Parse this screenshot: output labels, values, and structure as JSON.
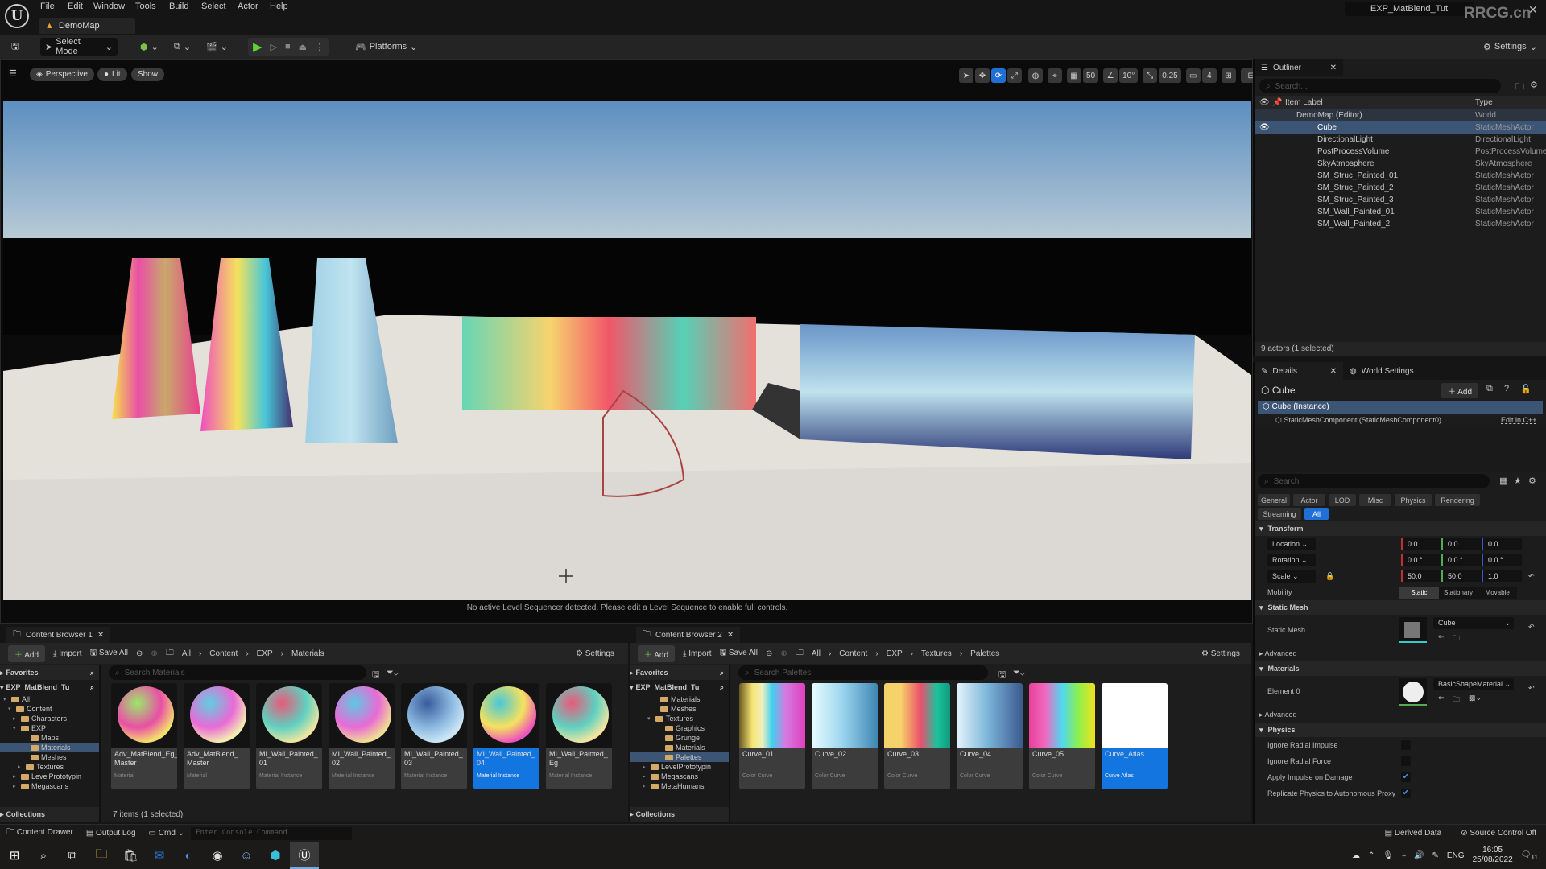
{
  "app": {
    "menu": [
      "File",
      "Edit",
      "Window",
      "Tools",
      "Build",
      "Select",
      "Actor",
      "Help"
    ],
    "map_tab": "DemoMap",
    "project_title": "EXP_MatBlend_Tut",
    "watermark": "RRCG.cn"
  },
  "toolbar": {
    "select_mode": "Select Mode",
    "platforms": "Platforms",
    "settings": "Settings"
  },
  "viewport": {
    "perspective": "Perspective",
    "lit": "Lit",
    "show": "Show",
    "grid_snap": "50",
    "rotation_snap": "10°",
    "scale_snap": "0.25",
    "camera_speed": "4",
    "sequencer_message": "No active Level Sequencer detected. Please edit a Level Sequence to enable full controls."
  },
  "outliner": {
    "tab": "Outliner",
    "search_placeholder": "Search...",
    "col_label": "Item Label",
    "col_type": "Type",
    "rows": [
      {
        "label": "DemoMap (Editor)",
        "type": "World"
      },
      {
        "label": "Cube",
        "type": "StaticMeshActor"
      },
      {
        "label": "DirectionalLight",
        "type": "DirectionalLight"
      },
      {
        "label": "PostProcessVolume",
        "type": "PostProcessVolume"
      },
      {
        "label": "SkyAtmosphere",
        "type": "SkyAtmosphere"
      },
      {
        "label": "SM_Struc_Painted_01",
        "type": "StaticMeshActor"
      },
      {
        "label": "SM_Struc_Painted_2",
        "type": "StaticMeshActor"
      },
      {
        "label": "SM_Struc_Painted_3",
        "type": "StaticMeshActor"
      },
      {
        "label": "SM_Wall_Painted_01",
        "type": "StaticMeshActor"
      },
      {
        "label": "SM_Wall_Painted_2",
        "type": "StaticMeshActor"
      }
    ],
    "status": "9 actors (1 selected)"
  },
  "details": {
    "tab": "Details",
    "world_settings_tab": "World Settings",
    "actor_name": "Cube",
    "add_label": "Add",
    "instance": "Cube (Instance)",
    "component": "StaticMeshComponent (StaticMeshComponent0)",
    "edit_cpp": "Edit in C++",
    "search_placeholder": "Search",
    "filters": [
      "General",
      "Actor",
      "LOD",
      "Misc",
      "Physics",
      "Rendering",
      "Streaming",
      "All"
    ],
    "transform_label": "Transform",
    "location_label": "Location",
    "rotation_label": "Rotation",
    "scale_label": "Scale",
    "location": [
      "0.0",
      "0.0",
      "0.0"
    ],
    "rotation": [
      "0.0 °",
      "0.0 °",
      "0.0 °"
    ],
    "scale": [
      "50.0",
      "50.0",
      "1.0"
    ],
    "mobility_label": "Mobility",
    "mobility_options": [
      "Static",
      "Stationary",
      "Movable"
    ],
    "static_mesh_section": "Static Mesh",
    "static_mesh_label": "Static Mesh",
    "static_mesh_value": "Cube",
    "advanced": "Advanced",
    "materials_section": "Materials",
    "element0_label": "Element 0",
    "element0_value": "BasicShapeMaterial",
    "physics_section": "Physics",
    "physics": [
      {
        "label": "Ignore Radial Impulse",
        "checked": false
      },
      {
        "label": "Ignore Radial Force",
        "checked": false
      },
      {
        "label": "Apply Impulse on Damage",
        "checked": true
      },
      {
        "label": "Replicate Physics to Autonomous Proxy",
        "checked": true
      }
    ]
  },
  "cb1": {
    "tab": "Content Browser 1",
    "add": "Add",
    "import": "Import",
    "save_all": "Save All",
    "settings": "Settings",
    "breadcrumb": [
      "All",
      "Content",
      "EXP",
      "Materials"
    ],
    "search_placeholder": "Search Materials",
    "favorites": "Favorites",
    "root": "EXP_MatBlend_Tu",
    "tree": [
      "All",
      "Content",
      "Characters",
      "EXP",
      "Maps",
      "Materials",
      "Meshes",
      "Textures",
      "LevelPrototypin",
      "Megascans"
    ],
    "collections": "Collections",
    "items": [
      {
        "name": "Adv_MatBlend_Eg_ Master",
        "type": "Material"
      },
      {
        "name": "Adv_MatBlend_ Master",
        "type": "Material"
      },
      {
        "name": "MI_Wall_Painted_ 01",
        "type": "Material Instance"
      },
      {
        "name": "MI_Wall_Painted_ 02",
        "type": "Material Instance"
      },
      {
        "name": "MI_Wall_Painted_ 03",
        "type": "Material Instance"
      },
      {
        "name": "MI_Wall_Painted_ 04",
        "type": "Material Instance"
      },
      {
        "name": "MI_Wall_Painted_ Eg",
        "type": "Material Instance"
      }
    ],
    "status": "7 items (1 selected)"
  },
  "cb2": {
    "tab": "Content Browser 2",
    "add": "Add",
    "import": "Import",
    "save_all": "Save All",
    "settings": "Settings",
    "breadcrumb": [
      "All",
      "Content",
      "EXP",
      "Textures",
      "Palettes"
    ],
    "search_placeholder": "Search Palettes",
    "favorites": "Favorites",
    "root": "EXP_MatBlend_Tu",
    "tree": [
      "Materials",
      "Meshes",
      "Textures",
      "Graphics",
      "Grunge",
      "Materials",
      "Palettes",
      "LevelPrototypin",
      "Megascans",
      "MetaHumans"
    ],
    "collections": "Collections",
    "items": [
      {
        "name": "Curve_01",
        "type": "Color Curve"
      },
      {
        "name": "Curve_02",
        "type": "Color Curve"
      },
      {
        "name": "Curve_03",
        "type": "Color Curve"
      },
      {
        "name": "Curve_04",
        "type": "Color Curve"
      },
      {
        "name": "Curve_05",
        "type": "Color Curve"
      },
      {
        "name": "Curve_Atlas",
        "type": "Curve Atlas"
      }
    ]
  },
  "statusbar": {
    "content_drawer": "Content Drawer",
    "output_log": "Output Log",
    "cmd": "Cmd",
    "console_placeholder": "Enter Console Command",
    "derived_data": "Derived Data",
    "source_control": "Source Control Off"
  },
  "taskbar": {
    "lang": "ENG",
    "time": "16:05",
    "date": "25/08/2022",
    "notifications": "11"
  },
  "colors": {
    "accent": "#1f6fd6",
    "selection": "#3d5575",
    "folder": "#d4a867"
  }
}
